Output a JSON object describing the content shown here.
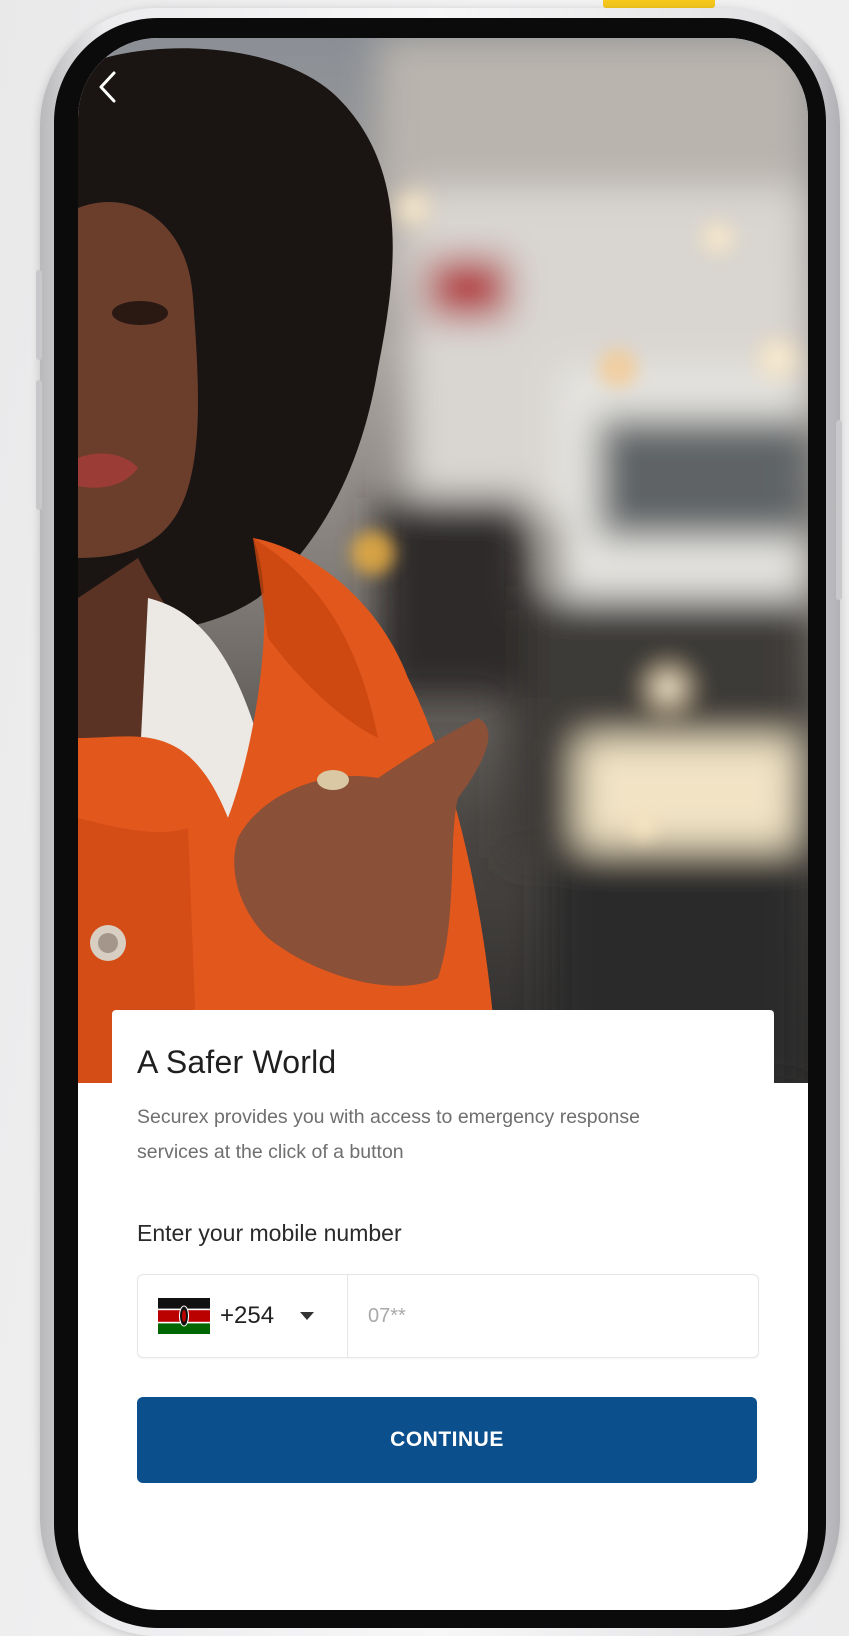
{
  "colors": {
    "accent_yellow": "#f6c81c",
    "primary_button": "#0b4f8c",
    "jacket_orange": "#e2571c"
  },
  "navigation": {
    "back_icon": "chevron-left-icon"
  },
  "card": {
    "title": "A Safer World",
    "description": "Securex provides you with access to emergency response services at the click of a button"
  },
  "form": {
    "label": "Enter your mobile number",
    "country": {
      "flag_icon": "kenya-flag-icon",
      "dial_code": "+254",
      "dropdown_icon": "caret-down-icon"
    },
    "phone": {
      "placeholder": "07**",
      "value": ""
    },
    "continue_label": "CONTINUE"
  }
}
